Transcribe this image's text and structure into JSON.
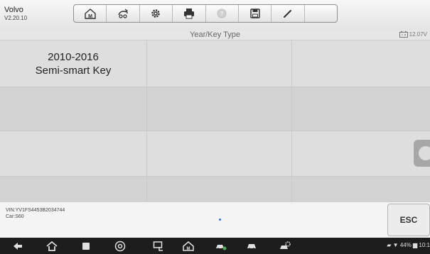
{
  "app": {
    "name": "Volvo",
    "version": "V2.20.10"
  },
  "toolbar": {
    "icons": [
      "home-icon",
      "vehicle-swap-icon",
      "settings-icon",
      "print-icon",
      "help-icon",
      "save-icon",
      "edit-icon"
    ]
  },
  "header": {
    "title": "Year/Key Type",
    "battery_voltage": "12.07V"
  },
  "grid": {
    "items": [
      {
        "line1": "2010-2016",
        "line2": "Semi-smart Key"
      }
    ]
  },
  "footer": {
    "vin": "VIN:YV1FS4453B2034744",
    "car": "Car:S60",
    "esc_label": "ESC"
  },
  "navbar": {
    "icons": [
      "back-icon",
      "home-icon",
      "recent-apps-icon",
      "chrome-icon",
      "remote-icon",
      "maxisys-home-icon",
      "car-service-icon",
      "car-icon",
      "car-settings-icon"
    ],
    "status_text": "44% ▆ 10:1"
  }
}
